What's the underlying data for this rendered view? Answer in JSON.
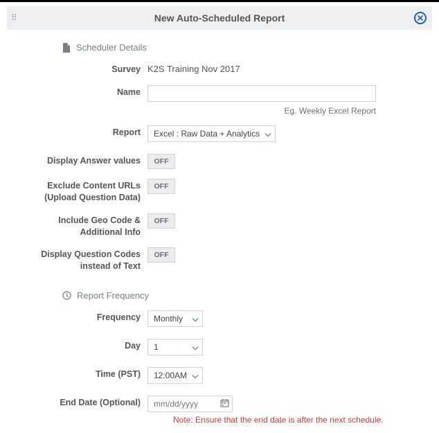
{
  "header": {
    "title": "New Auto-Scheduled Report"
  },
  "sections": {
    "details": {
      "title": "Scheduler Details"
    },
    "frequency": {
      "title": "Report Frequency"
    }
  },
  "fields": {
    "survey": {
      "label": "Survey",
      "value": "K2S Training Nov 2017"
    },
    "name": {
      "label": "Name",
      "value": "",
      "hint": "Eg. Weekly Excel Report"
    },
    "report": {
      "label": "Report",
      "value": "Excel : Raw Data + Analytics"
    },
    "display_answer_values": {
      "label": "Display Answer values",
      "value": "OFF"
    },
    "exclude_content_urls": {
      "label": "Exclude Content URLs (Upload Question Data)",
      "value": "OFF"
    },
    "include_geo": {
      "label": "Include Geo Code & Additional Info",
      "value": "OFF"
    },
    "display_q_codes": {
      "label": "Display Question Codes instead of Text",
      "value": "OFF"
    },
    "freq": {
      "label": "Frequency",
      "value": "Monthly"
    },
    "day": {
      "label": "Day",
      "value": "1"
    },
    "time": {
      "label": "Time (PST)",
      "value": "12:00AM"
    },
    "end_date": {
      "label": "End Date (Optional)",
      "placeholder": "mm/dd/yyyy",
      "note": "Note: Ensure that the end date is after the next schedule."
    }
  }
}
